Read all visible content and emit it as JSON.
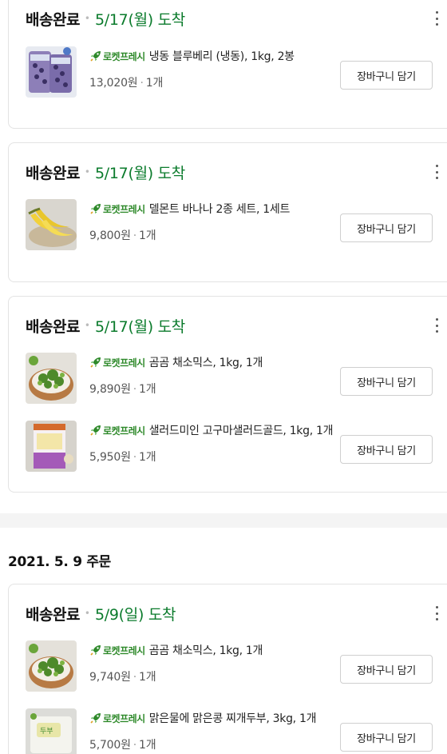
{
  "colors": {
    "accent_green": "#0b7b2c",
    "badge_green": "#2f8a2b",
    "border": "#e3e3e3"
  },
  "badge": {
    "label": "로켓프레시",
    "icon": "rocket-icon"
  },
  "orders": [
    {
      "date": "",
      "groups": [
        {
          "status": "배송완료",
          "arrival": "5/17(월) 도착",
          "items": [
            {
              "name": "냉동 블루베리 (냉동), 1kg, 2봉",
              "price": "13,020원",
              "qty": "1개",
              "button": "장바구니 담기"
            }
          ]
        },
        {
          "status": "배송완료",
          "arrival": "5/17(월) 도착",
          "items": [
            {
              "name": "델몬트 바나나 2종 세트, 1세트",
              "price": "9,800원",
              "qty": "1개",
              "button": "장바구니 담기"
            }
          ]
        },
        {
          "status": "배송완료",
          "arrival": "5/17(월) 도착",
          "items": [
            {
              "name": "곰곰 채소믹스, 1kg, 1개",
              "price": "9,890원",
              "qty": "1개",
              "button": "장바구니 담기"
            },
            {
              "name": "샐러드미인 고구마샐러드골드, 1kg, 1개",
              "price": "5,950원",
              "qty": "1개",
              "button": "장바구니 담기"
            }
          ]
        }
      ]
    },
    {
      "date": "2021. 5. 9 주문",
      "groups": [
        {
          "status": "배송완료",
          "arrival": "5/9(일) 도착",
          "items": [
            {
              "name": "곰곰 채소믹스, 1kg, 1개",
              "price": "9,740원",
              "qty": "1개",
              "button": "장바구니 담기"
            },
            {
              "name": "맑은물에 맑은콩 찌개두부, 3kg, 1개",
              "price": "5,700원",
              "qty": "1개",
              "button": "장바구니 담기"
            }
          ]
        }
      ]
    }
  ]
}
